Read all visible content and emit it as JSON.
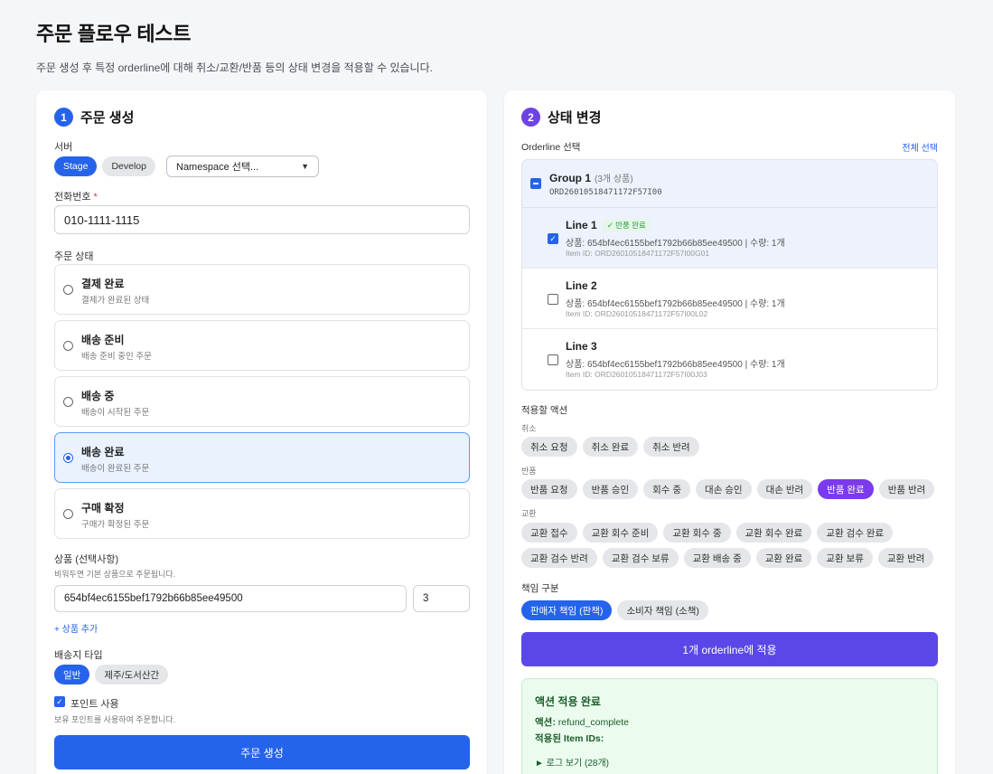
{
  "page": {
    "title": "주문 플로우 테스트",
    "description": "주문 생성 후 특정 orderline에 대해 취소/교환/반품 등의 상태 변경을 적용할 수 있습니다."
  },
  "create": {
    "step": "1",
    "title": "주문 생성",
    "server_label": "서버",
    "servers": [
      "Stage",
      "Develop"
    ],
    "selected_server": "Stage",
    "namespace_placeholder": "Namespace 선택...",
    "phone_label": "전화번호",
    "phone_required": "*",
    "phone_value": "010-1111-1115",
    "status_label": "주문 상태",
    "statuses": [
      {
        "title": "결제 완료",
        "desc": "결제가 완료된 상태"
      },
      {
        "title": "배송 준비",
        "desc": "배송 준비 중인 주문"
      },
      {
        "title": "배송 중",
        "desc": "배송이 시작된 주문"
      },
      {
        "title": "배송 완료",
        "desc": "배송이 완료된 주문"
      },
      {
        "title": "구매 확정",
        "desc": "구매가 확정된 주문"
      }
    ],
    "selected_status": "배송 완료",
    "product_label": "상품 (선택사항)",
    "product_hint": "비워두면 기본 상품으로 주문됩니다.",
    "product_id": "654bf4ec6155bef1792b66b85ee49500",
    "product_qty": "3",
    "add_product": "+ 상품 추가",
    "shipping_label": "배송지 타입",
    "shipping_types": [
      "일반",
      "제주/도서산간"
    ],
    "selected_shipping": "일반",
    "point_label": "포인트 사용",
    "point_hint": "보유 포인트를 사용하여 주문합니다.",
    "point_checked": true,
    "submit_label": "주문 생성"
  },
  "change": {
    "step": "2",
    "title": "상태 변경",
    "orderline_label": "Orderline 선택",
    "select_all": "전체 선택",
    "group": {
      "name": "Group 1",
      "count": "(3개 상품)",
      "order_id": "ORD26010518471172F57I00"
    },
    "lines": [
      {
        "name": "Line 1",
        "badge": "✓ 반품 완료",
        "product": "상품: 654bf4ec6155bef1792b66b85ee49500 | 수량: 1개",
        "item_id": "Item ID: ORD26010518471172F57I00G01",
        "checked": true
      },
      {
        "name": "Line 2",
        "badge": "",
        "product": "상품: 654bf4ec6155bef1792b66b85ee49500 | 수량: 1개",
        "item_id": "Item ID: ORD26010518471172F57I00L02",
        "checked": false
      },
      {
        "name": "Line 3",
        "badge": "",
        "product": "상품: 654bf4ec6155bef1792b66b85ee49500 | 수량: 1개",
        "item_id": "Item ID: ORD26010518471172F57I00J03",
        "checked": false
      }
    ],
    "action_label": "적용할 액션",
    "cancel_label": "취소",
    "cancel_actions": [
      "취소 요청",
      "취소 완료",
      "취소 반려"
    ],
    "return_label": "반품",
    "return_actions": [
      "반품 요청",
      "반품 승인",
      "회수 중",
      "대손 승인",
      "대손 반려",
      "반품 완료",
      "반품 반려"
    ],
    "selected_action": "반품 완료",
    "exchange_label": "교환",
    "exchange_actions_row1": [
      "교환 접수",
      "교환 회수 준비",
      "교환 회수 중",
      "교환 회수 완료",
      "교환 검수 완료"
    ],
    "exchange_actions_row2": [
      "교환 검수 반려",
      "교환 검수 보류",
      "교환 배송 중",
      "교환 완료",
      "교환 보류",
      "교환 반려"
    ],
    "responsibility_label": "책임 구분",
    "responsibilities": [
      "판매자 책임 (판책)",
      "소비자 책임 (소책)"
    ],
    "selected_responsibility": "판매자 책임 (판책)",
    "apply_label": "1개 orderline에 적용",
    "result": {
      "title": "액션 적용 완료",
      "action_key": "액션:",
      "action_value": "refund_complete",
      "items_key": "적용된 Item IDs:",
      "log_toggle": "► 로그 보기 (28개)"
    }
  },
  "colors": {
    "primary": "#2563eb",
    "step2": "#6d42e6",
    "apply_button": "#5b47e8",
    "selected_action": "#7c3aed",
    "success_bg": "#ebfbee"
  }
}
